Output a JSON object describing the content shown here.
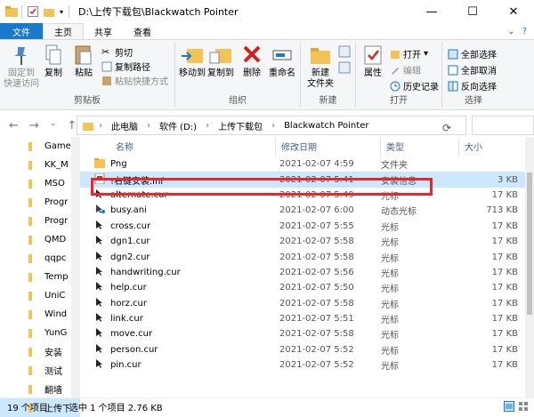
{
  "window": {
    "title": "D:\\上传下载包\\Blackwatch Pointer",
    "controls": [
      "—",
      "☐",
      "✕"
    ]
  },
  "tabs": [
    "文件",
    "主页",
    "共享",
    "查看"
  ],
  "ribbon": {
    "clipboard": {
      "pin": "固定到\n快速访问",
      "copy": "复制",
      "paste": "粘贴",
      "cut": "剪切",
      "copy_path": "复制路径",
      "paste_shortcut": "粘贴快捷方式",
      "label": "剪贴板"
    },
    "organize": {
      "move_to": "移动到",
      "copy_to": "复制到",
      "delete": "删除",
      "rename": "重命名",
      "label": "组织"
    },
    "new": {
      "new_folder": "新建\n文件夹",
      "label": "新建"
    },
    "open": {
      "properties": "属性",
      "open": "打开",
      "edit": "编辑",
      "history": "历史记录",
      "label": "打开"
    },
    "select": {
      "select_all": "全部选择",
      "select_none": "全部取消",
      "invert": "反向选择",
      "label": "选择"
    }
  },
  "address": {
    "parts": [
      "此电脑",
      "软件 (D:)",
      "上传下载包",
      "Blackwatch Pointer"
    ]
  },
  "nav_items": [
    "Game",
    "KK_M",
    "MSO",
    "Progr",
    "Progr",
    "QMD",
    "qqpc",
    "Temp",
    "UniC",
    "Wind",
    "YunG",
    "安装",
    "测试",
    "翻墙",
    "上传下"
  ],
  "columns": {
    "name": "名称",
    "date": "修改日期",
    "type": "类型",
    "size": "大小"
  },
  "files": [
    {
      "name": "Png",
      "date": "2021-02-07 4:59",
      "type": "文件夹",
      "size": "",
      "kind": "folder"
    },
    {
      "name": "!右键安装.inf",
      "date": "2021-02-07 5:41",
      "type": "安装信息",
      "size": "3 KB",
      "kind": "inf"
    },
    {
      "name": "alternate.cur",
      "date": "2021-02-07 5:49",
      "type": "光标",
      "size": "17 KB",
      "kind": "cur"
    },
    {
      "name": "busy.ani",
      "date": "2021-02-07 6:00",
      "type": "动态光标",
      "size": "713 KB",
      "kind": "ani"
    },
    {
      "name": "cross.cur",
      "date": "2021-02-07 5:55",
      "type": "光标",
      "size": "17 KB",
      "kind": "cur"
    },
    {
      "name": "dgn1.cur",
      "date": "2021-02-07 5:58",
      "type": "光标",
      "size": "17 KB",
      "kind": "cur"
    },
    {
      "name": "dgn2.cur",
      "date": "2021-02-07 5:58",
      "type": "光标",
      "size": "17 KB",
      "kind": "cur"
    },
    {
      "name": "handwriting.cur",
      "date": "2021-02-07 5:56",
      "type": "光标",
      "size": "17 KB",
      "kind": "cur"
    },
    {
      "name": "help.cur",
      "date": "2021-02-07 5:50",
      "type": "光标",
      "size": "17 KB",
      "kind": "cur"
    },
    {
      "name": "horz.cur",
      "date": "2021-02-07 5:58",
      "type": "光标",
      "size": "17 KB",
      "kind": "cur"
    },
    {
      "name": "link.cur",
      "date": "2021-02-07 5:51",
      "type": "光标",
      "size": "17 KB",
      "kind": "cur"
    },
    {
      "name": "move.cur",
      "date": "2021-02-07 5:58",
      "type": "光标",
      "size": "17 KB",
      "kind": "cur"
    },
    {
      "name": "person.cur",
      "date": "2021-02-07 5:52",
      "type": "光标",
      "size": "17 KB",
      "kind": "cur"
    },
    {
      "name": "pin.cur",
      "date": "2021-02-07 5:52",
      "type": "光标",
      "size": "17 KB",
      "kind": "cur"
    }
  ],
  "status": {
    "count": "19 个项目",
    "selected": "选中 1 个项目  2.76 KB"
  },
  "colors": {
    "accent": "#1979ca",
    "selection": "#cce8ff",
    "highlight_box": "#e8262b",
    "folder": "#f3c453"
  }
}
